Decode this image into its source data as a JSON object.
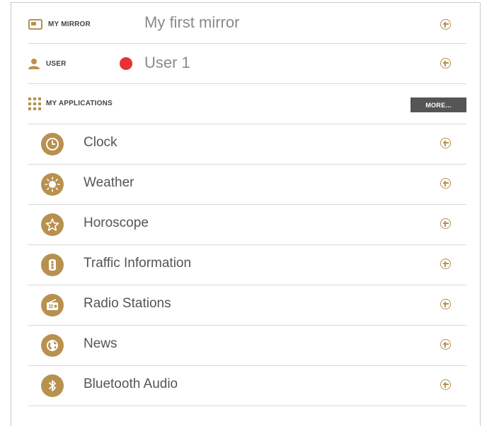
{
  "mirror": {
    "label": "MY MIRROR",
    "value": "My first mirror",
    "icon": "screen-icon"
  },
  "user": {
    "label": "USER",
    "value": "User 1",
    "icon": "person-icon",
    "status_color": "#e53232"
  },
  "applications": {
    "label": "MY APPLICATIONS",
    "icon": "grid-icon",
    "more_label": "MORE...",
    "items": [
      {
        "label": "Clock",
        "icon": "clock-icon"
      },
      {
        "label": "Weather",
        "icon": "sun-icon"
      },
      {
        "label": "Horoscope",
        "icon": "star-icon"
      },
      {
        "label": "Traffic Information",
        "icon": "traffic-light-icon"
      },
      {
        "label": "Radio Stations",
        "icon": "radio-icon"
      },
      {
        "label": "News",
        "icon": "globe-icon"
      },
      {
        "label": "Bluetooth Audio",
        "icon": "bluetooth-icon"
      }
    ]
  },
  "colors": {
    "accent": "#b8914f",
    "button_bg": "#555555",
    "divider": "#d9d9d9"
  }
}
